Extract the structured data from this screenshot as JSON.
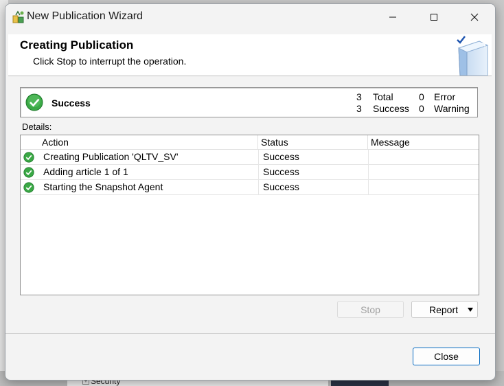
{
  "window": {
    "title": "New Publication Wizard"
  },
  "header": {
    "title": "Creating Publication",
    "subtitle": "Click Stop to interrupt the operation."
  },
  "summary": {
    "status": "Success",
    "total_count": "3",
    "total_label": "Total",
    "success_count": "3",
    "success_label": "Success",
    "error_count": "0",
    "error_label": "Error",
    "warning_count": "0",
    "warning_label": "Warning"
  },
  "details": {
    "label": "Details:",
    "columns": [
      "Action",
      "Status",
      "Message"
    ],
    "rows": [
      {
        "action": "Creating Publication 'QLTV_SV'",
        "status": "Success",
        "message": ""
      },
      {
        "action": "Adding article 1 of 1",
        "status": "Success",
        "message": ""
      },
      {
        "action": "Starting the Snapshot Agent",
        "status": "Success",
        "message": ""
      }
    ]
  },
  "buttons": {
    "stop": "Stop",
    "report": "Report",
    "close": "Close"
  },
  "background": {
    "tree_item": "Security"
  },
  "colors": {
    "success_green": "#3aa845",
    "accent_blue": "#0067c0"
  },
  "icons": {
    "app": "publication-wizard-icon",
    "status": "success-check-icon",
    "header": "book-check-icon"
  }
}
